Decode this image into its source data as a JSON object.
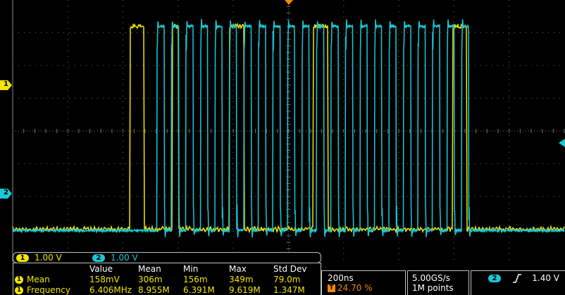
{
  "colors": {
    "background": "#000000",
    "grid": "#6f6f6f",
    "ch1": "#f2e600",
    "ch2": "#19c9d6",
    "trigger": "#f08a00",
    "frame": "#c0c0c0"
  },
  "channels": [
    {
      "id": "1",
      "color": "#f2e600",
      "scale": "1.00 V"
    },
    {
      "id": "2",
      "color": "#19c9d6",
      "scale": "1.00 V"
    }
  ],
  "measurements": {
    "headers": [
      "Value",
      "Mean",
      "Min",
      "Max",
      "Std Dev"
    ],
    "rows": [
      {
        "source": "1",
        "label": "Mean",
        "values": [
          "158mV",
          "306m",
          "156m",
          "349m",
          "79.0m"
        ]
      },
      {
        "source": "1",
        "label": "Frequency",
        "values": [
          "6.406MHz",
          "8.955M",
          "6.391M",
          "9.619M",
          "1.347M"
        ]
      }
    ]
  },
  "timebase": {
    "scale": "200ns",
    "trigger_position": "24.70 %"
  },
  "acquisition": {
    "sample_rate": "5.00GS/s",
    "record_length": "1M points"
  },
  "trigger": {
    "source": "2",
    "slope_icon": "rising-edge-icon",
    "level": "1.40 V"
  },
  "waveforms": {
    "ch1_pulses": [
      [
        0.2127,
        0.2377
      ],
      [
        0.2887,
        0.301
      ],
      [
        0.3924,
        0.4193
      ],
      [
        0.5444,
        0.5712
      ],
      [
        0.7974,
        0.8236
      ]
    ],
    "ch2_burst": [
      0.2615,
      0.84
    ],
    "ch2_cycles": 22,
    "ch1_levels": [
      0.125,
      0.9
    ],
    "ch2_levels": [
      0.12,
      0.9
    ]
  }
}
